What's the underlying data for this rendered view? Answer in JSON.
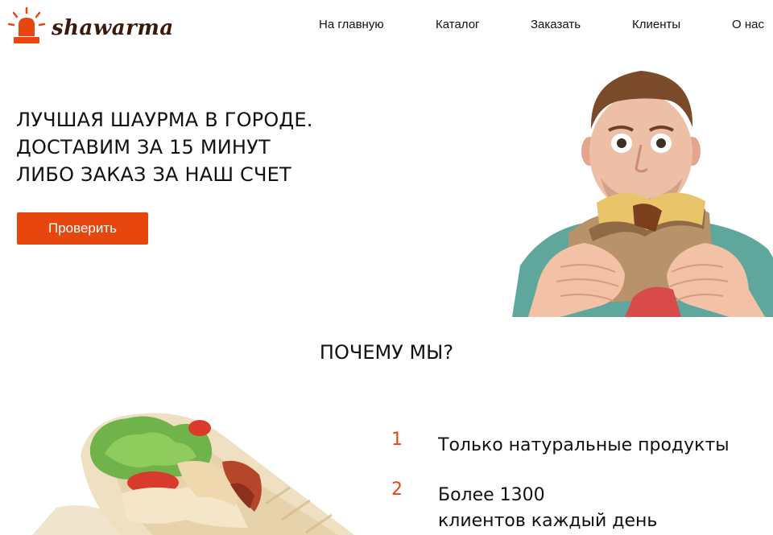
{
  "brand": {
    "name": "shawarma",
    "accent_color": "#e8460f",
    "logo_icon": "siren-light-icon"
  },
  "nav": {
    "items": [
      {
        "label": "На главную"
      },
      {
        "label": "Каталог"
      },
      {
        "label": "Заказать"
      },
      {
        "label": "Клиенты"
      },
      {
        "label": "О нас"
      }
    ]
  },
  "hero": {
    "title_lines": [
      "ЛУЧШАЯ ШАУРМА В ГОРОДЕ.",
      "ДОСТАВИМ ЗА 15 МИНУТ",
      "ЛИБО ЗАКАЗ ЗА НАШ СЧЕТ"
    ],
    "button_label": "Проверить",
    "photo_subject": "man-eating-shawarma-photo"
  },
  "why": {
    "title": "ПОЧЕМУ МЫ?",
    "photo_subject": "shawarma-wrap-photo",
    "features": [
      {
        "number": "1",
        "lines": [
          "Только натуральные продукты"
        ]
      },
      {
        "number": "2",
        "lines": [
          "Более 1300",
          "клиентов каждый день"
        ]
      }
    ]
  }
}
